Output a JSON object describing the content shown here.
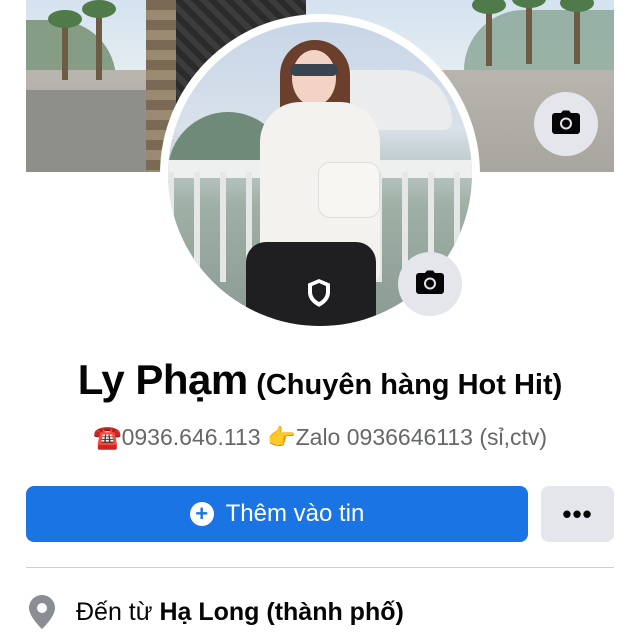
{
  "profile": {
    "name": "Ly Phạm",
    "name_suffix": "(Chuyên hàng Hot Hit)",
    "bio": "☎️0936.646.113 👉Zalo 0936646113 (sỉ,ctv)"
  },
  "actions": {
    "add_story_label": "Thêm vào tin",
    "more_label": "•••"
  },
  "details": {
    "hometown_prefix": "Đến từ ",
    "hometown_place": "Hạ Long (thành phố)"
  },
  "colors": {
    "primary_blue": "#1b74e4",
    "secondary_button": "#e4e6eb",
    "text_primary": "#050505",
    "text_secondary": "#65676b",
    "divider": "#ced0d4"
  },
  "icons": {
    "cover_camera": "camera-icon",
    "avatar_camera": "camera-icon",
    "profile_guard": "shield-icon",
    "add_story": "plus-circle-icon",
    "more": "more-horizontal-icon",
    "hometown": "location-pin-icon"
  }
}
